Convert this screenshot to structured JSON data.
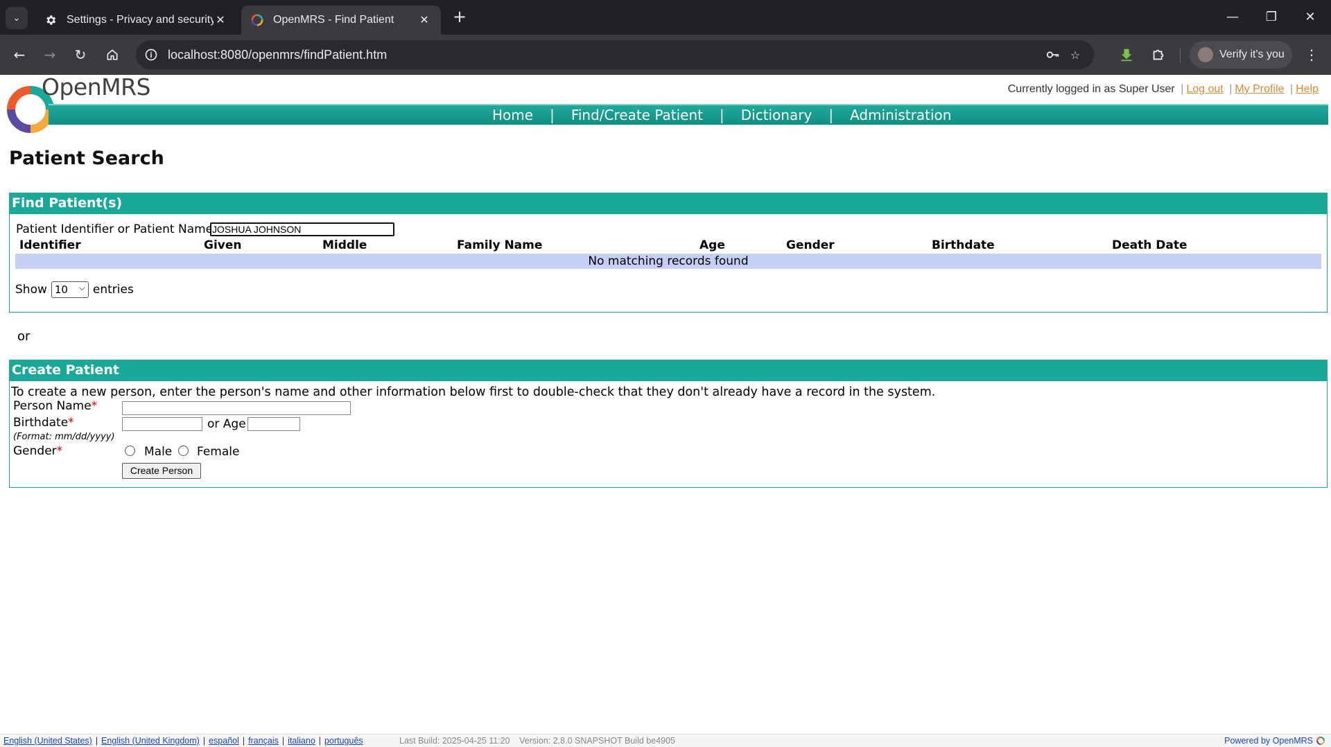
{
  "browser": {
    "tabs": [
      {
        "title": "Settings - Privacy and security",
        "icon": "gear-icon",
        "active": false
      },
      {
        "title": "OpenMRS - Find Patient",
        "icon": "openmrs-favicon",
        "active": true
      }
    ],
    "url": "localhost:8080/openmrs/findPatient.htm",
    "verify_label": "Verify it's you"
  },
  "header": {
    "logo_text": "OpenMRS",
    "logged_in_text": "Currently logged in as Super User",
    "logout": "Log out",
    "my_profile": "My Profile",
    "help": "Help"
  },
  "nav": {
    "items": [
      "Home",
      "Find/Create Patient",
      "Dictionary",
      "Administration"
    ]
  },
  "page_title": "Patient Search",
  "find": {
    "header": "Find Patient(s)",
    "label": "Patient Identifier or Patient Name:",
    "input_value": "JOSHUA JOHNSON",
    "columns": [
      "Identifier",
      "Given",
      "Middle",
      "Family Name",
      "Age",
      "Gender",
      "Birthdate",
      "Death Date"
    ],
    "empty_message": "No matching records found",
    "show_label": "Show",
    "entries_value": "10",
    "entries_label": "entries"
  },
  "or_text": "or",
  "create": {
    "header": "Create Patient",
    "intro": "To create a new person, enter the person's name and other information below first to double-check that they don't already have a record in the system.",
    "person_name_label": "Person Name",
    "birthdate_label": "Birthdate",
    "format_hint": "(Format: mm/dd/yyyy)",
    "or_age_label": "or Age",
    "gender_label": "Gender",
    "male_label": "Male",
    "female_label": "Female",
    "required_mark": "*",
    "button_label": "Create Person"
  },
  "footer": {
    "languages": [
      "English (United States)",
      "English (United Kingdom)",
      "español",
      "français",
      "italiano",
      "português"
    ],
    "last_build": "Last Build: 2025-04-25 11:20",
    "version": "Version: 2.8.0 SNAPSHOT Build be4905",
    "powered_by": "Powered by OpenMRS"
  },
  "colors": {
    "brand_teal": "#1aa898",
    "link_orange": "#d98b35",
    "empty_row_bg": "#c5cff4"
  }
}
